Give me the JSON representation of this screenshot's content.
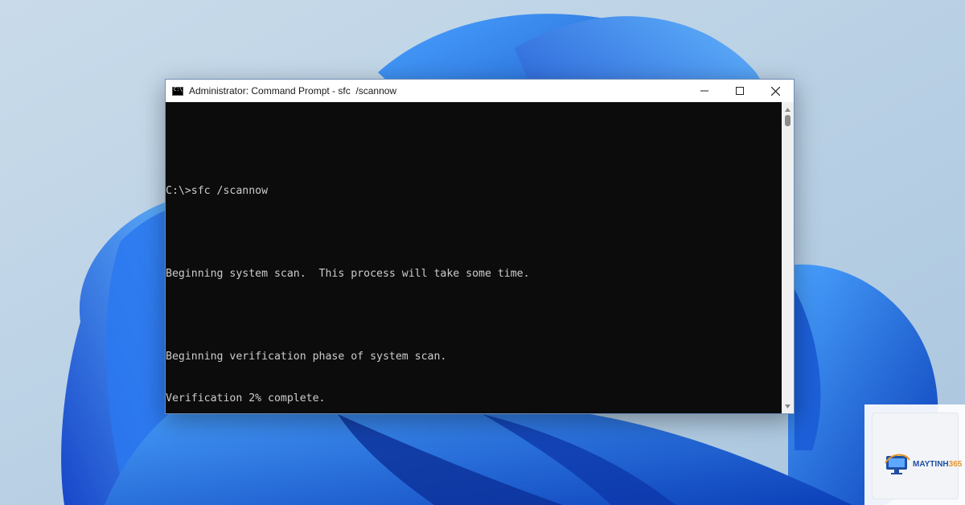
{
  "window": {
    "title": "Administrator: Command Prompt - sfc  /scannow",
    "controls": {
      "minimize_icon": "minimize-icon",
      "maximize_icon": "maximize-icon",
      "close_icon": "close-icon"
    }
  },
  "console": {
    "lines": [
      "",
      "C:\\>sfc /scannow",
      "",
      "Beginning system scan.  This process will take some time.",
      "",
      "Beginning verification phase of system scan.",
      "Verification 2% complete."
    ]
  },
  "watermark": {
    "brand_primary": "MAYTINH",
    "brand_accent": "365"
  },
  "colors": {
    "console_bg": "#0c0c0c",
    "console_fg": "#cccccc",
    "wallpaper_blue": "#1d63e0"
  }
}
